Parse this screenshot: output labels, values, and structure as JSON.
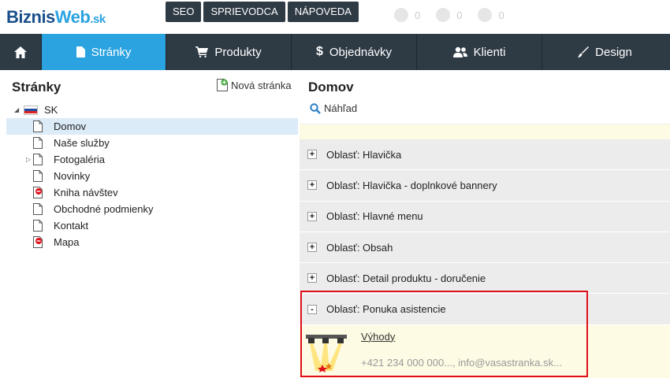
{
  "header": {
    "logo_part1": "Biznis",
    "logo_part2": "Web",
    "logo_part3": ".sk",
    "top_links": [
      "SEO",
      "SPRIEVODCA",
      "NÁPOVEDA"
    ],
    "tray_counts": [
      "0",
      "0",
      "0"
    ]
  },
  "nav": {
    "items": [
      {
        "label": "",
        "icon": "home-icon"
      },
      {
        "label": "Stránky",
        "icon": "page-icon",
        "active": true
      },
      {
        "label": "Produkty",
        "icon": "cart-icon"
      },
      {
        "label": "Objednávky",
        "icon": "dollar-icon"
      },
      {
        "label": "Klienti",
        "icon": "users-icon"
      },
      {
        "label": "Design",
        "icon": "brush-icon"
      }
    ]
  },
  "left": {
    "title": "Stránky",
    "new_page": "Nová stránka",
    "root": "SK",
    "pages": [
      "Domov",
      "Naše služby",
      "Fotogaléria",
      "Novinky",
      "Kniha návštev",
      "Obchodné podmienky",
      "Kontakt",
      "Mapa"
    ]
  },
  "right": {
    "title": "Domov",
    "preview": "Náhľad",
    "areas": [
      "Oblasť: Hlavička",
      "Oblasť: Hlavička - doplnkové bannery",
      "Oblasť: Hlavné menu",
      "Oblasť: Obsah",
      "Oblasť: Detail produktu - doručenie",
      "Oblasť: Ponuka asistencie"
    ],
    "expanded_content": {
      "link": "Výhody",
      "description": "+421 234 000 000..., info@vasastranka.sk..."
    }
  },
  "colors": {
    "nav_bg": "#2e3a44",
    "nav_active": "#2ba3e0",
    "highlight": "#e0101a",
    "selected_row": "#dcebf8"
  }
}
